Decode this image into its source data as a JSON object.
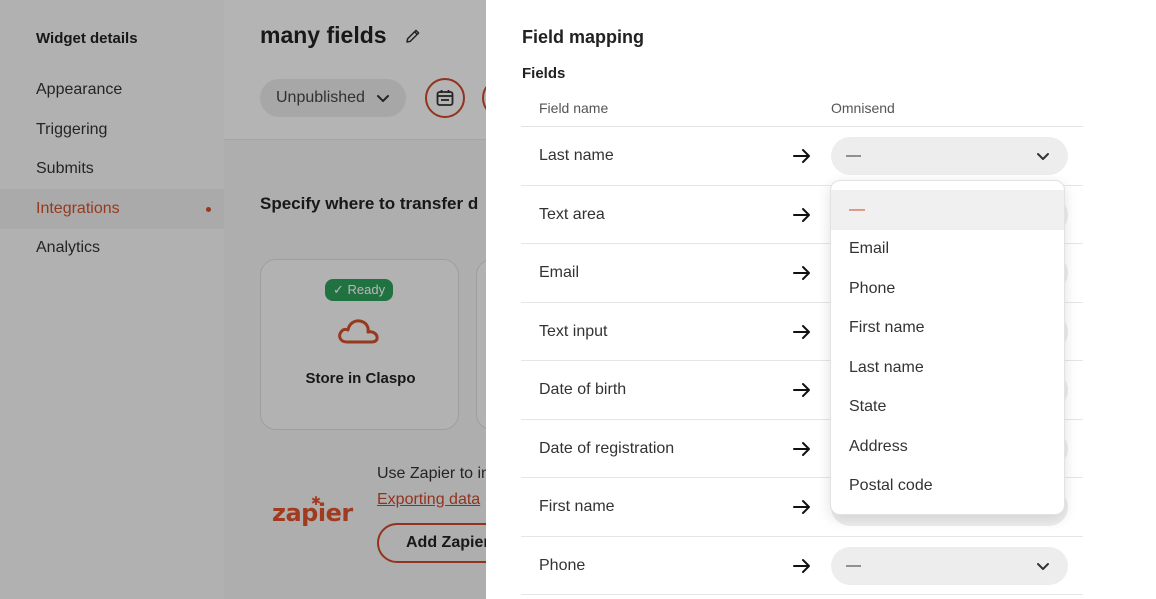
{
  "sidebar": {
    "title": "Widget details",
    "items": [
      {
        "label": "Appearance"
      },
      {
        "label": "Triggering"
      },
      {
        "label": "Submits"
      },
      {
        "label": "Integrations"
      },
      {
        "label": "Analytics"
      }
    ]
  },
  "header": {
    "title": "many fields",
    "status": "Unpublished"
  },
  "main": {
    "section_heading": "Specify where to transfer d",
    "card": {
      "badge": "✓ Ready",
      "label": "Store in Claspo"
    },
    "zapier": {
      "logo": "zapier",
      "text": "Use Zapier to in",
      "link": "Exporting data",
      "button": "Add Zapier"
    }
  },
  "drawer": {
    "title": "Field mapping",
    "fields_label": "Fields",
    "col_field_name": "Field name",
    "col_omnisend": "Omnisend",
    "rows": [
      {
        "label": "Last name",
        "value": "—"
      },
      {
        "label": "Text area",
        "value": ""
      },
      {
        "label": "Email",
        "value": ""
      },
      {
        "label": "Text input",
        "value": ""
      },
      {
        "label": "Date of birth",
        "value": ""
      },
      {
        "label": "Date of registration",
        "value": ""
      },
      {
        "label": "First name",
        "value": ""
      },
      {
        "label": "Phone",
        "value": "—"
      }
    ]
  },
  "dropdown": {
    "options": [
      "—",
      "Email",
      "Phone",
      "First name",
      "Last name",
      "State",
      "Address",
      "Postal code"
    ]
  },
  "colors": {
    "accent": "#d0502b",
    "badge_green": "#2e9e5b"
  }
}
